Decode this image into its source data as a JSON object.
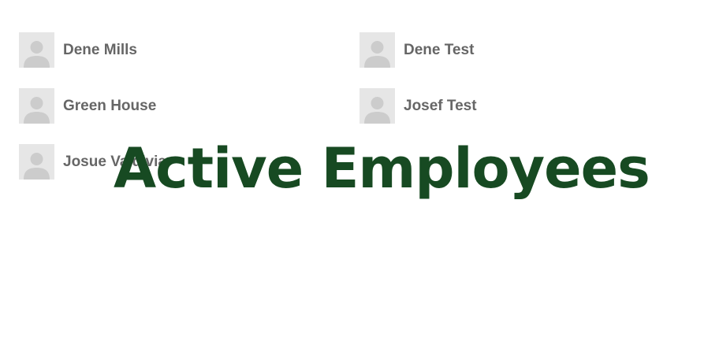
{
  "page": {
    "title": "Active Employees"
  },
  "colors": {
    "title": "#174a22",
    "name_text": "#666666",
    "avatar_bg": "#e6e6e6",
    "avatar_silhouette": "#cccccc"
  },
  "employees": [
    {
      "name": "Dene Mills",
      "icon": "user-placeholder-icon"
    },
    {
      "name": "Dene Test",
      "icon": "user-placeholder-icon"
    },
    {
      "name": "Green House",
      "icon": "user-placeholder-icon"
    },
    {
      "name": "Josef Test",
      "icon": "user-placeholder-icon"
    },
    {
      "name": "Josue Valdivia",
      "icon": "user-placeholder-icon"
    }
  ]
}
